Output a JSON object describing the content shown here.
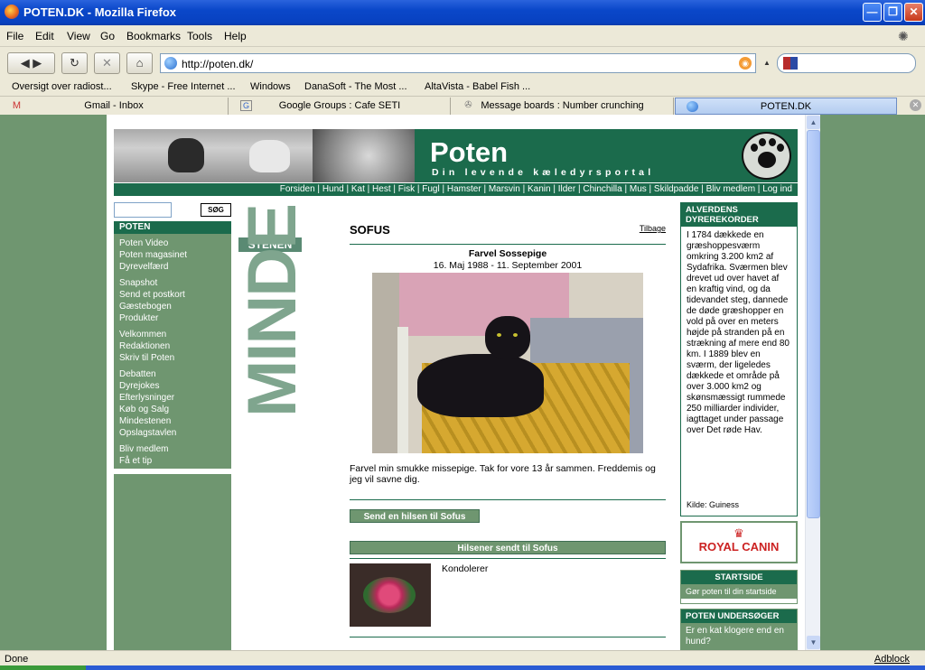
{
  "window": {
    "title": "POTEN.DK - Mozilla Firefox",
    "controls": {
      "minimize": "—",
      "maximize": "❐",
      "close": "✕"
    }
  },
  "menu": [
    "File",
    "Edit",
    "View",
    "Go",
    "Bookmarks",
    "Tools",
    "Help"
  ],
  "nav": {
    "back": "◀ ▶",
    "reload": "↻",
    "stop": "✕",
    "home": "⌂",
    "url": "http://poten.dk/",
    "dropdown": "▲"
  },
  "bookmarks": [
    "Oversigt over radiost...",
    "Skype - Free Internet ...",
    "Windows",
    "DanaSoft - The Most ...",
    "AltaVista - Babel Fish ..."
  ],
  "tabs": [
    {
      "label": "Gmail - Inbox",
      "icon": "gmail-icon"
    },
    {
      "label": "Google Groups : Cafe SETI",
      "icon": "google-icon"
    },
    {
      "label": "Message boards : Number crunching",
      "icon": "satellite-icon"
    },
    {
      "label": "POTEN.DK",
      "icon": "globe-icon",
      "active": true
    }
  ],
  "site": {
    "logo": "Poten",
    "tagline": "Din levende kæledyrsportal",
    "topnav": [
      "Forsiden",
      "Hund",
      "Kat",
      "Hest",
      "Fisk",
      "Fugl",
      "Hamster",
      "Marsvin",
      "Kanin",
      "Ilder",
      "Chinchilla",
      "Mus",
      "Skildpadde",
      "Bliv medlem",
      "Log ind"
    ],
    "search_button": "SØG",
    "leftnav": {
      "header": "POTEN",
      "links": [
        [
          "Poten Video",
          "Poten magasinet",
          "Dyrevelfærd"
        ],
        [
          "Snapshot",
          "Send et postkort",
          "Gæstebogen",
          "Produkter"
        ],
        [
          "Velkommen",
          "Redaktionen",
          "Skriv til Poten"
        ],
        [
          "Debatten",
          "Dyrejokes",
          "Efterlysninger",
          "Køb og Salg",
          "Mindestenen",
          "Opslagstavlen"
        ],
        [
          "Bliv medlem",
          "Få et tip"
        ]
      ]
    },
    "minde": {
      "word1": "MINDE",
      "word2": "STENEN"
    }
  },
  "main": {
    "pet_name": "SOFUS",
    "back_link": "Tilbage",
    "farewell_title": "Farvel Sossepige",
    "dates": "16. Maj 1988 - 11. September 2001",
    "message": "Farvel min smukke missepige. Tak for vore 13 år sammen. Freddemis og jeg vil savne dig.",
    "send_greeting": "Send en hilsen til Sofus",
    "greetings_header": "Hilsener sendt til Sofus",
    "greeting_text": "Kondolerer"
  },
  "right": {
    "records_header": "ALVERDENS DYREREKORDER",
    "records_body": "I 1784 dækkede en græshoppesværm omkring 3.200 km2 af Sydafrika. Sværmen blev drevet ud over havet af en kraftig vind, og da tidevandet steg, dannede de døde græshopper en vold på over en meters højde på stranden på en strækning af mere end 80 km. I 1889 blev en sværm, der ligeledes dækkede et område på over 3.000 km2 og skønsmæssigt rummede 250 milliarder individer, iagttaget under passage over Det røde Hav.",
    "records_source": "Kilde: Guiness",
    "royal_canin": "ROYAL CANIN",
    "startside_header": "STARTSIDE",
    "startside_body": "Gør poten til din startside",
    "undersoeger_header": "POTEN UNDERSØGER",
    "undersoeger_body": "Er en kat klogere end en hund?"
  },
  "status": {
    "text": "Done",
    "addon": "Adblock"
  },
  "colors": {
    "brand_green": "#1b6b4c",
    "sage": "#6f9670"
  }
}
